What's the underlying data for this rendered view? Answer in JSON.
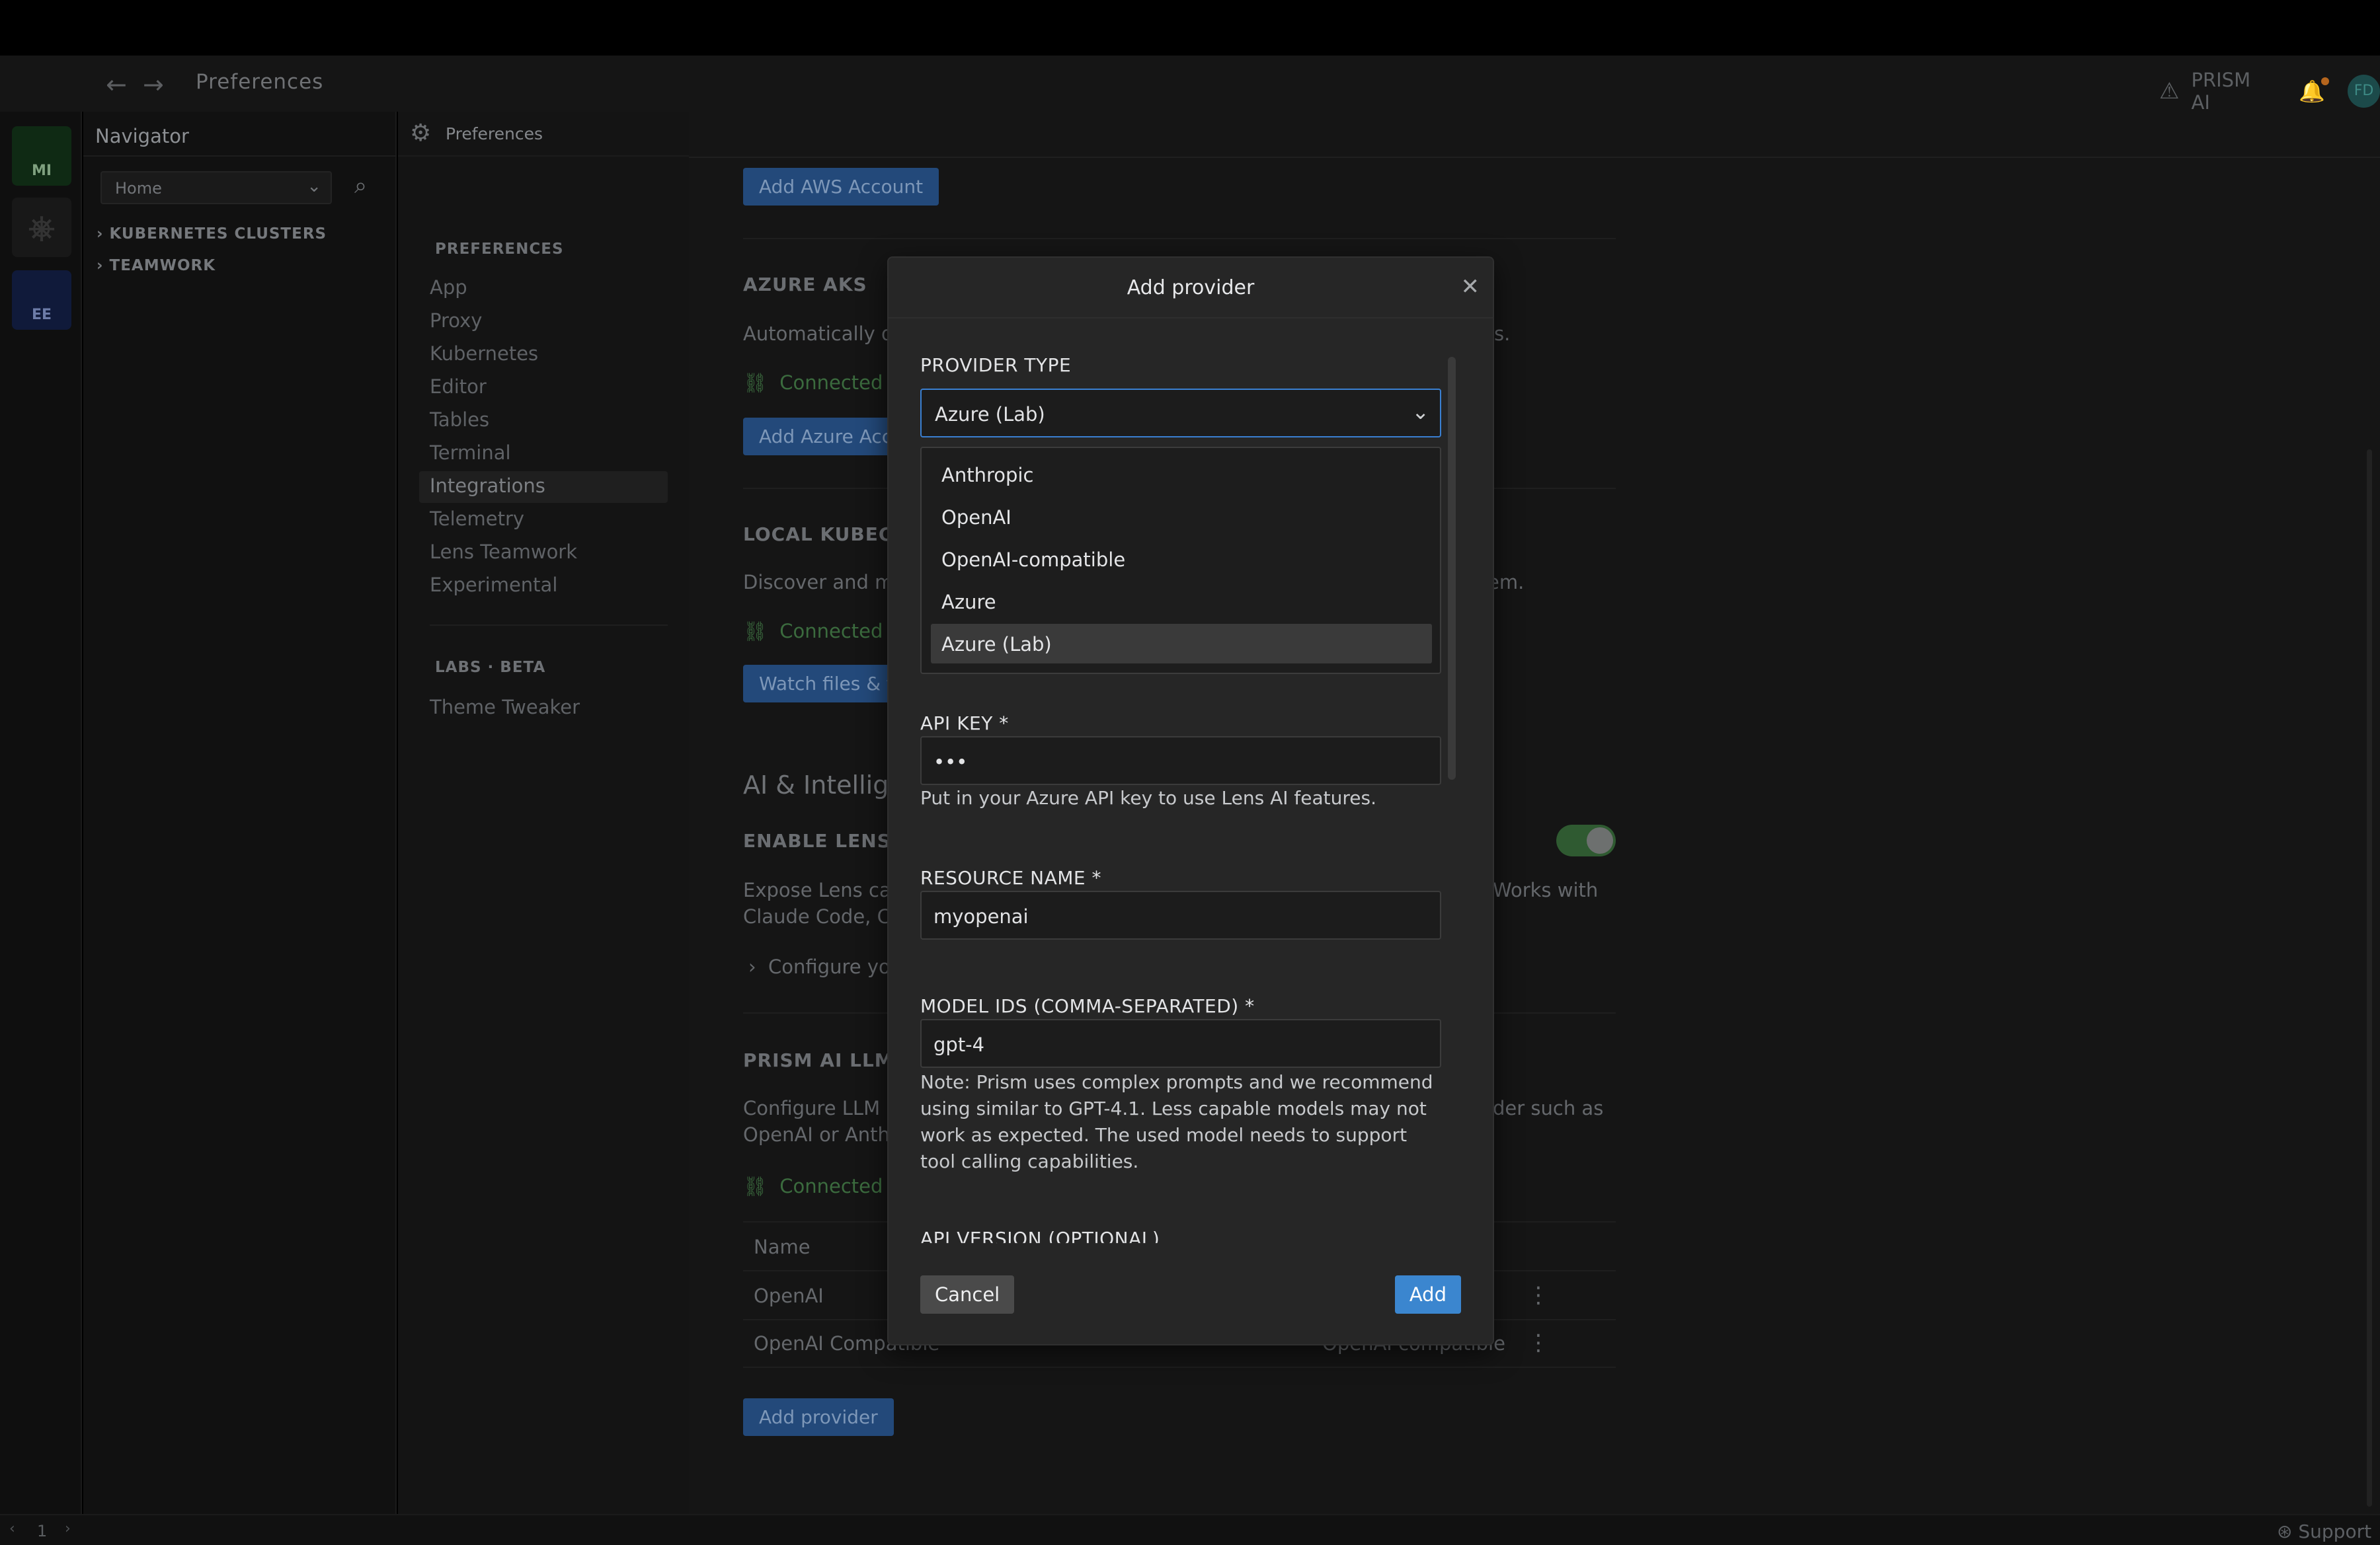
{
  "titlebar": {
    "title": "Preferences",
    "back_glyph": "←",
    "forward_glyph": "→",
    "prism_label": "PRISM AI",
    "avatar_initials": "FD"
  },
  "rail": {
    "items": [
      "MI",
      "",
      "EE"
    ]
  },
  "navigator": {
    "title": "Navigator",
    "select_value": "Home",
    "tree": [
      "KUBERNETES CLUSTERS",
      "TEAMWORK"
    ]
  },
  "preferences_tab": {
    "label": "Preferences"
  },
  "preferences_nav": {
    "heading": "PREFERENCES",
    "items": [
      "App",
      "Proxy",
      "Kubernetes",
      "Editor",
      "Tables",
      "Terminal",
      "Integrations",
      "Telemetry",
      "Lens Teamwork",
      "Experimental"
    ],
    "active": "Integrations",
    "labs_heading": "LABS · BETA",
    "labs_items": [
      "Theme Tweaker"
    ]
  },
  "content": {
    "add_aws_button": "Add AWS Account",
    "azure_heading": "AZURE AKS",
    "azure_desc_left": "Automatically di",
    "azure_desc_right": "s.",
    "azure_status": "Connected",
    "add_azure_button": "Add Azure Acco",
    "local_heading": "LOCAL KUBECON",
    "local_desc_left": "Discover and ma",
    "local_desc_right": "em.",
    "local_status": "Connected",
    "watch_button": "Watch files & f",
    "ai_heading": "AI & Intellige",
    "enable_heading": "ENABLE LENS M",
    "expose_line1": "Expose Lens cap",
    "expose_line2": "Claude Code, Cu",
    "expose_right": "Works with",
    "configure_link": "Configure yo",
    "prism_heading": "PRISM AI LLM PR",
    "configure_line1": "Configure LLM p",
    "configure_line2": "OpenAI or Anthr",
    "configure_right": "der such as",
    "prism_status": "Connected",
    "table_header_name": "Name",
    "table_rows": [
      {
        "name": "OpenAI",
        "type": ""
      },
      {
        "name": "OpenAI Compatible",
        "type": "OpenAI compatible"
      }
    ],
    "add_provider_button": "Add provider"
  },
  "modal": {
    "title": "Add provider",
    "provider_type_label": "PROVIDER TYPE",
    "provider_type_value": "Azure (Lab)",
    "options": [
      "Anthropic",
      "OpenAI",
      "OpenAI-compatible",
      "Azure",
      "Azure (Lab)"
    ],
    "selected_option": "Azure (Lab)",
    "api_key_label": "API KEY *",
    "api_key_value": "•••",
    "api_key_hint": "Put in your Azure API key to use Lens AI features.",
    "resource_label": "RESOURCE NAME *",
    "resource_value": "myopenai",
    "model_label": "MODEL IDS (COMMA-SEPARATED) *",
    "model_value": "gpt-4",
    "model_note": "Note: Prism uses complex prompts and we recommend using similar to GPT-4.1. Less capable models may not work as expected. The used model needs to support tool calling capabilities.",
    "api_version_label": "API VERSION (OPTIONAL)",
    "cancel_label": "Cancel",
    "add_label": "Add"
  },
  "statusbar": {
    "page": "1",
    "support": "Support"
  },
  "colors": {
    "accent": "#3b86cf",
    "connected": "#3b6b3e",
    "modal_bg": "#262626"
  }
}
